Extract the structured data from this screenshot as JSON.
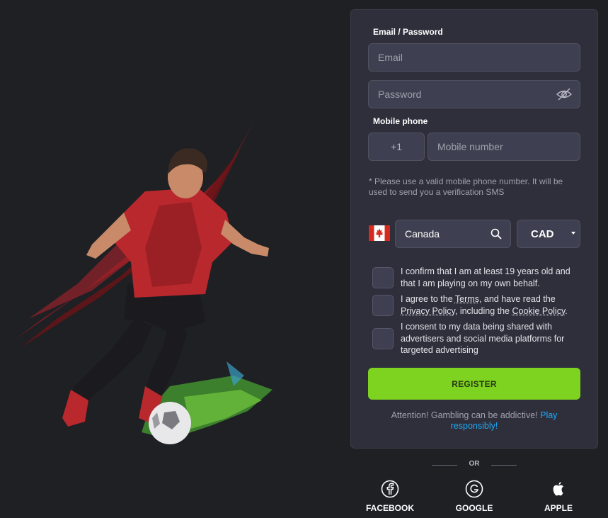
{
  "form": {
    "email_password_label": "Email / Password",
    "email_placeholder": "Email",
    "password_placeholder": "Password",
    "mobile_label": "Mobile phone",
    "phone_code": "+1",
    "mobile_placeholder": "Mobile number",
    "phone_hint": "* Please use a valid mobile phone number. It will be used to send you a verification SMS",
    "country": "Canada",
    "currency": "CAD",
    "checks": [
      {
        "text_a": "I confirm that I am at least 19 years old and that I am playing on my own behalf."
      },
      {
        "pre": "I agree to the ",
        "terms": "Terms",
        "mid": ", and have read the ",
        "privacy": "Privacy Policy",
        "mid2": ", including the ",
        "cookie": "Cookie Policy",
        "end": "."
      },
      {
        "text_a": "I consent to my data being shared with advertisers and social media platforms for targeted advertising"
      }
    ],
    "register_label": "REGISTER",
    "attention_text": "Attention! Gambling can be addictive! ",
    "attention_link": "Play responsibly!"
  },
  "or_label": "OR",
  "social": {
    "facebook": "FACEBOOK",
    "google": "GOOGLE",
    "apple": "APPLE"
  },
  "colors": {
    "background": "#1e2024",
    "card": "#2e2f3b",
    "field": "#3e3f50",
    "accent_green": "#7ed321",
    "link_blue": "#1fa9f5"
  }
}
